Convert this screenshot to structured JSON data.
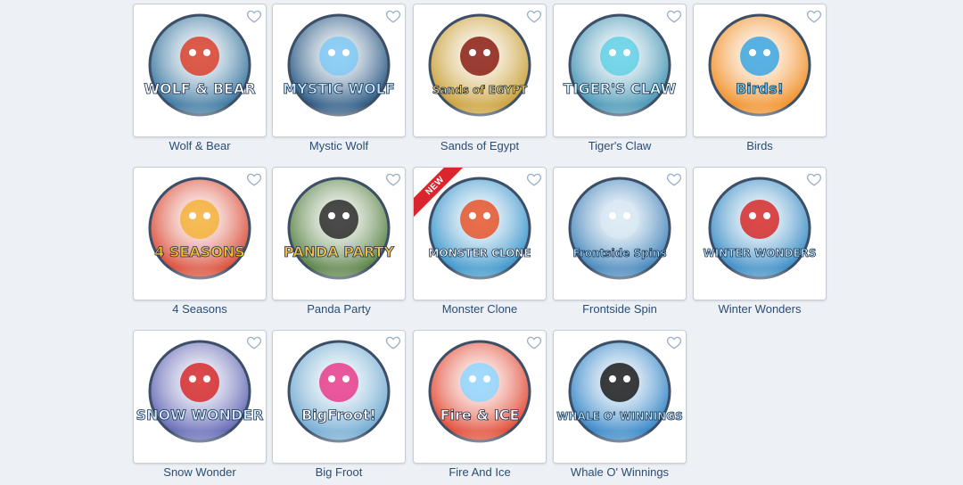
{
  "games": [
    {
      "name": "Wolf & Bear",
      "logo": "WOLF & BEAR",
      "bg": "#2f6f9a",
      "accent": "#d9402a",
      "logo_color": "#ffffff",
      "new": false
    },
    {
      "name": "Mystic Wolf",
      "logo": "MYSTIC WOLF",
      "bg": "#1d4e7c",
      "accent": "#7fc8f5",
      "logo_color": "#bfe6ff",
      "new": false
    },
    {
      "name": "Sands of Egypt",
      "logo": "Sands of EGYPT",
      "bg": "#c79a2d",
      "accent": "#8a1c13",
      "logo_color": "#f5d36b",
      "new": false
    },
    {
      "name": "Tiger's Claw",
      "logo": "TIGER'S CLAW",
      "bg": "#3b8fb0",
      "accent": "#62d0e6",
      "logo_color": "#dff6ff",
      "new": false
    },
    {
      "name": "Birds",
      "logo": "Birds!",
      "bg": "#f08a1d",
      "accent": "#39a6e2",
      "logo_color": "#5cc6f2",
      "new": false
    },
    {
      "name": "4 Seasons",
      "logo": "4 SEASONS",
      "bg": "#d8422c",
      "accent": "#f4b23a",
      "logo_color": "#f4c233",
      "new": false
    },
    {
      "name": "Panda Party",
      "logo": "PANDA PARTY",
      "bg": "#4f7a3a",
      "accent": "#2b2b2b",
      "logo_color": "#f2c04a",
      "new": false
    },
    {
      "name": "Monster Clone",
      "logo": "MONSTER CLONE",
      "bg": "#2f8fc8",
      "accent": "#e6552a",
      "logo_color": "#ffffff",
      "new": true
    },
    {
      "name": "Frontside Spin",
      "logo": "Frontside Spins",
      "bg": "#3a7fb8",
      "accent": "#d9e9f2",
      "logo_color": "#9fdcff",
      "new": false
    },
    {
      "name": "Winter Wonders",
      "logo": "WINTER WONDERS",
      "bg": "#2f86c2",
      "accent": "#d62a2a",
      "logo_color": "#bfe8ff",
      "new": false
    },
    {
      "name": "Snow Wonder",
      "logo": "SNOW WONDER",
      "bg": "#5a5fb0",
      "accent": "#d62a2a",
      "logo_color": "#cfeaff",
      "new": false
    },
    {
      "name": "Big Froot",
      "logo": "BigFroot!",
      "bg": "#6aa6cf",
      "accent": "#e83b8b",
      "logo_color": "#ffffff",
      "new": false
    },
    {
      "name": "Fire And Ice",
      "logo": "Fire & ICE",
      "bg": "#e0402a",
      "accent": "#8fd6ff",
      "logo_color": "#ffffff",
      "new": false
    },
    {
      "name": "Whale O' Winnings",
      "logo": "WHALE O' WINNINGS",
      "bg": "#2a7fc4",
      "accent": "#1b1b1b",
      "logo_color": "#bfe8ff",
      "new": false
    }
  ],
  "new_badge": "NEW",
  "icons": {
    "favorite": "heart-outline-icon"
  },
  "colors": {
    "heart": "#9ab0c6",
    "label": "#2a4c73",
    "ribbon": "#d9252b"
  }
}
